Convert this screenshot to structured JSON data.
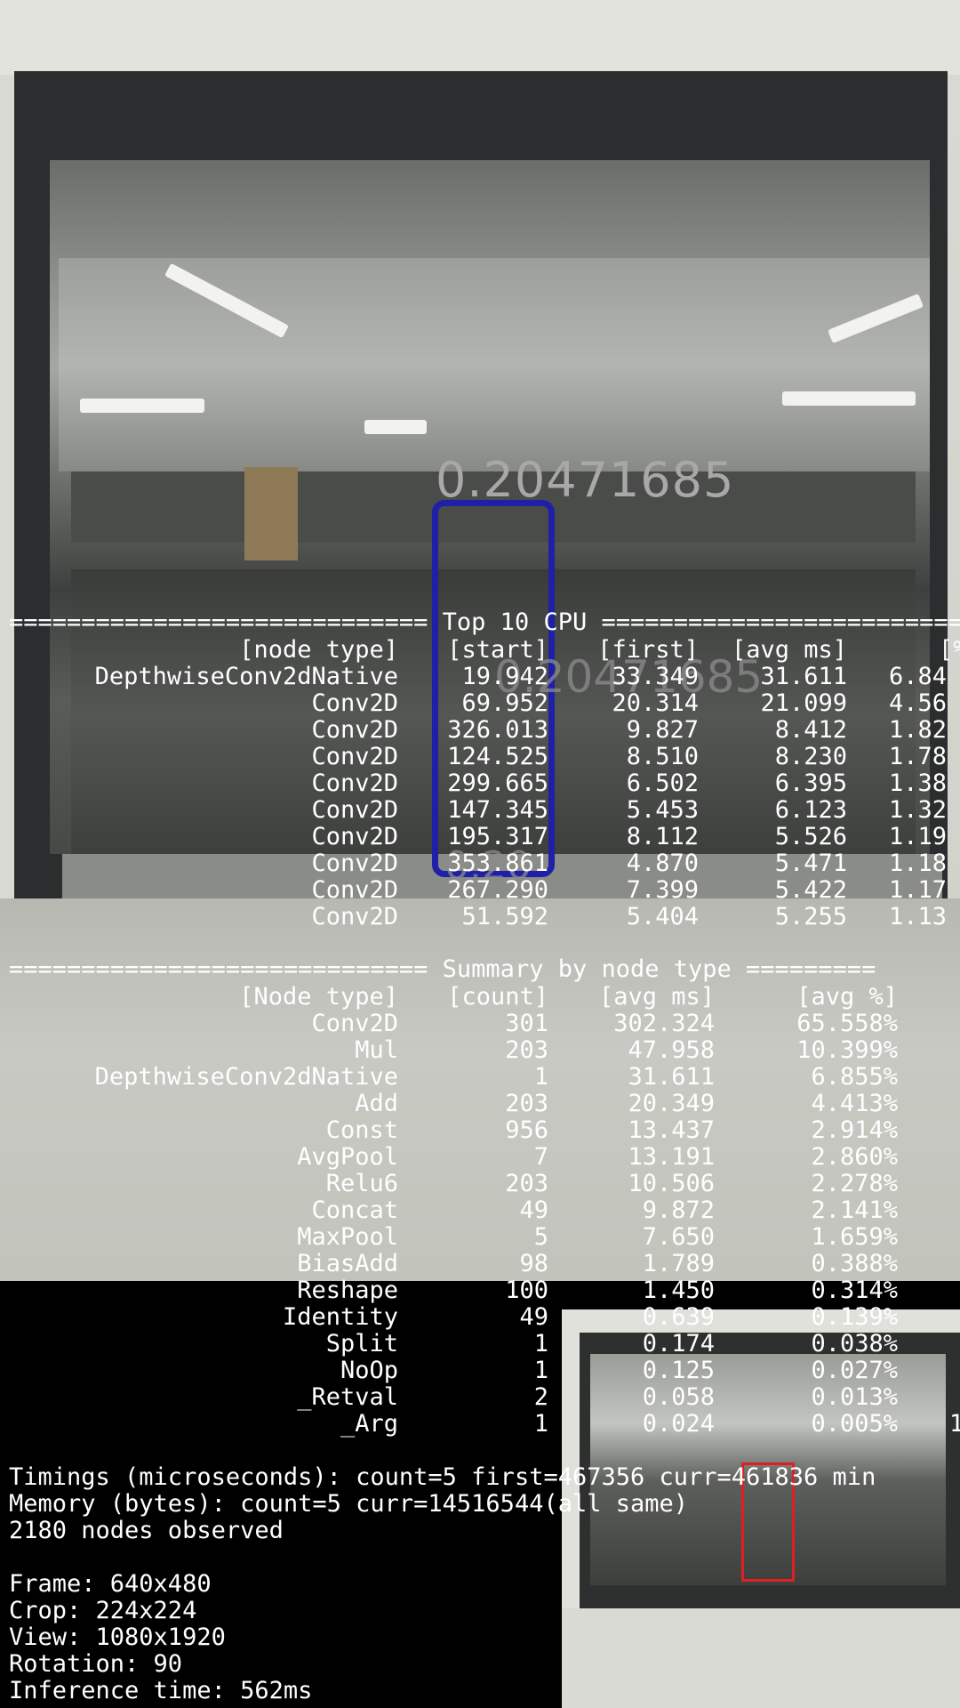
{
  "detection": {
    "score": "0.20471685",
    "ghost_score_1": "0.20471685",
    "ghost_score_2": "0.20"
  },
  "top_cpu": {
    "header": "============================= Top 10 CPU ============================",
    "columns": [
      "[node type]",
      "[start]",
      "[first]",
      "[avg ms]",
      "[%"
    ],
    "rows": [
      [
        "DepthwiseConv2dNative",
        "19.942",
        "33.349",
        "31.611",
        "6.84"
      ],
      [
        "Conv2D",
        "69.952",
        "20.314",
        "21.099",
        "4.56"
      ],
      [
        "Conv2D",
        "326.013",
        "9.827",
        "8.412",
        "1.82"
      ],
      [
        "Conv2D",
        "124.525",
        "8.510",
        "8.230",
        "1.78"
      ],
      [
        "Conv2D",
        "299.665",
        "6.502",
        "6.395",
        "1.38"
      ],
      [
        "Conv2D",
        "147.345",
        "5.453",
        "6.123",
        "1.32"
      ],
      [
        "Conv2D",
        "195.317",
        "8.112",
        "5.526",
        "1.19"
      ],
      [
        "Conv2D",
        "353.861",
        "4.870",
        "5.471",
        "1.18"
      ],
      [
        "Conv2D",
        "267.290",
        "7.399",
        "5.422",
        "1.17"
      ],
      [
        "Conv2D",
        "51.592",
        "5.404",
        "5.255",
        "1.13"
      ]
    ]
  },
  "summary": {
    "header": "============================= Summary by node type =========",
    "columns": [
      "[Node type]",
      "[count]",
      "[avg ms]",
      "[avg %]"
    ],
    "rows": [
      [
        "Conv2D",
        "301",
        "302.324",
        "65.558%"
      ],
      [
        "Mul",
        "203",
        "47.958",
        "10.399%"
      ],
      [
        "DepthwiseConv2dNative",
        "1",
        "31.611",
        "6.855%"
      ],
      [
        "Add",
        "203",
        "20.349",
        "4.413%"
      ],
      [
        "Const",
        "956",
        "13.437",
        "2.914%"
      ],
      [
        "AvgPool",
        "7",
        "13.191",
        "2.860%"
      ],
      [
        "Relu6",
        "203",
        "10.506",
        "2.278%"
      ],
      [
        "Concat",
        "49",
        "9.872",
        "2.141%"
      ],
      [
        "MaxPool",
        "5",
        "7.650",
        "1.659%"
      ],
      [
        "BiasAdd",
        "98",
        "1.789",
        "0.388%"
      ],
      [
        "Reshape",
        "100",
        "1.450",
        "0.314%"
      ],
      [
        "Identity",
        "49",
        "0.639",
        "0.139%"
      ],
      [
        "Split",
        "1",
        "0.174",
        "0.038%"
      ],
      [
        "NoOp",
        "1",
        "0.125",
        "0.027%"
      ],
      [
        "_Retval",
        "2",
        "0.058",
        "0.013%"
      ],
      [
        "_Arg",
        "1",
        "0.024",
        "0.005%"
      ]
    ],
    "trailing_char": "1"
  },
  "footer": {
    "timings": "Timings (microseconds): count=5 first=467356 curr=461836 min",
    "memory": "Memory (bytes): count=5 curr=14516544(all same)",
    "nodes": "2180 nodes observed",
    "frame": "Frame: 640x480",
    "crop": "Crop: 224x224",
    "view": "View: 1080x1920",
    "rotation": "Rotation: 90",
    "inference": "Inference time: 562ms"
  }
}
